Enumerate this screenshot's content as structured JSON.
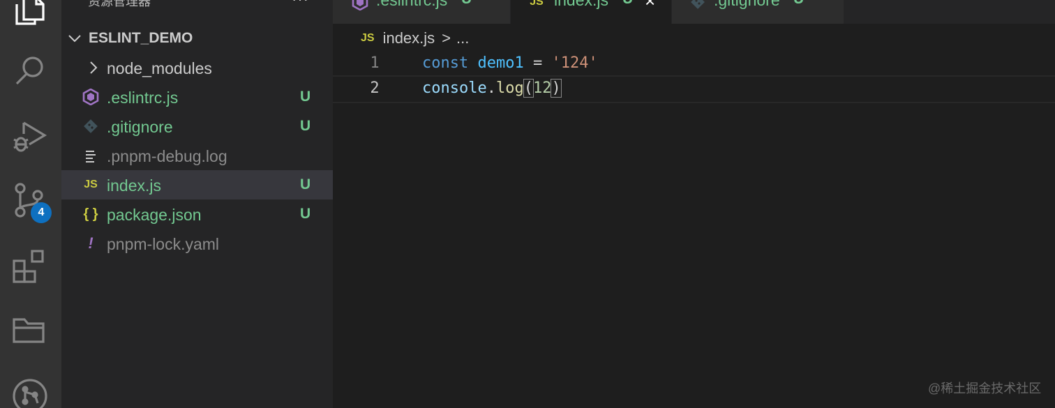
{
  "sidebar": {
    "header": "资源管理器",
    "more_label": "···",
    "folder": "ESLINT_DEMO",
    "items": [
      {
        "label": "node_modules",
        "status": "",
        "icon": "chevron-right-icon"
      },
      {
        "label": ".eslintrc.js",
        "status": "U",
        "icon": "eslint-icon"
      },
      {
        "label": ".gitignore",
        "status": "U",
        "icon": "git-icon"
      },
      {
        "label": ".pnpm-debug.log",
        "status": "",
        "icon": "log-file-icon"
      },
      {
        "label": "index.js",
        "status": "U",
        "icon": "js-file-icon",
        "glyph": "JS"
      },
      {
        "label": "package.json",
        "status": "U",
        "icon": "json-file-icon",
        "glyph": "{ }"
      },
      {
        "label": "pnpm-lock.yaml",
        "status": "",
        "icon": "yaml-file-icon",
        "glyph": "!"
      }
    ]
  },
  "activity": {
    "scm_badge": "4",
    "icons": [
      "explorer-icon",
      "search-icon",
      "run-debug-icon",
      "source-control-icon",
      "extensions-icon",
      "folders-icon",
      "git-graph-icon"
    ]
  },
  "tabs": [
    {
      "label": ".eslintrc.js",
      "status": "U",
      "active": false
    },
    {
      "label": "index.js",
      "status": "U",
      "active": true,
      "glyph": "JS",
      "close": "×"
    },
    {
      "label": ".gitignore",
      "status": "U",
      "active": false
    }
  ],
  "breadcrumb": {
    "glyph": "JS",
    "file": "index.js",
    "separator": ">",
    "more": "..."
  },
  "editor": {
    "lines": [
      {
        "num": "1",
        "tokens": {
          "kw": "const",
          "var": "demo1",
          "op": "=",
          "str": "'124'"
        }
      },
      {
        "num": "2",
        "tokens": {
          "ident": "console",
          "dot": ".",
          "fn": "log",
          "open": "(",
          "num": "12",
          "close": ")"
        }
      }
    ]
  },
  "watermark": "@稀土掘金技术社区",
  "colors": {
    "git_untracked": "#73c991",
    "badge": "#0e70c0",
    "js_yellow": "#cbcb41"
  }
}
